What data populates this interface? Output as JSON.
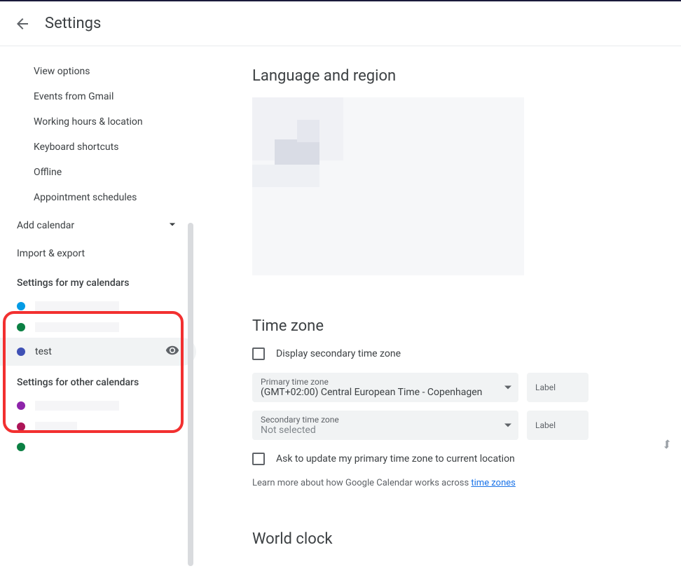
{
  "header": {
    "title": "Settings"
  },
  "sidebar": {
    "general_items": [
      "View options",
      "Events from Gmail",
      "Working hours & location",
      "Keyboard shortcuts",
      "Offline",
      "Appointment schedules"
    ],
    "add_calendar": "Add calendar",
    "import_export": "Import & export",
    "my_calendars_heading": "Settings for my calendars",
    "my_calendars": [
      {
        "color": "#039be5",
        "name": ""
      },
      {
        "color": "#0b8043",
        "name": ""
      },
      {
        "color": "#3f51b5",
        "name": "test"
      }
    ],
    "other_calendars_heading": "Settings for other calendars",
    "other_calendars": [
      {
        "color": "#8e24aa",
        "name": ""
      },
      {
        "color": "#ad1457",
        "name": ""
      },
      {
        "color": "#0b8043",
        "name": ""
      }
    ]
  },
  "main": {
    "language_region_title": "Language and region",
    "time_zone_title": "Time zone",
    "display_secondary_label": "Display secondary time zone",
    "primary_tz_label": "Primary time zone",
    "primary_tz_value": "(GMT+02:00) Central European Time - Copenhagen",
    "secondary_tz_label": "Secondary time zone",
    "secondary_tz_value": "Not selected",
    "label_text": "Label",
    "ask_update_label": "Ask to update my primary time zone to current location",
    "learn_more_prefix": "Learn more about how Google Calendar works across ",
    "learn_more_link": "time zones",
    "world_clock_title": "World clock"
  }
}
